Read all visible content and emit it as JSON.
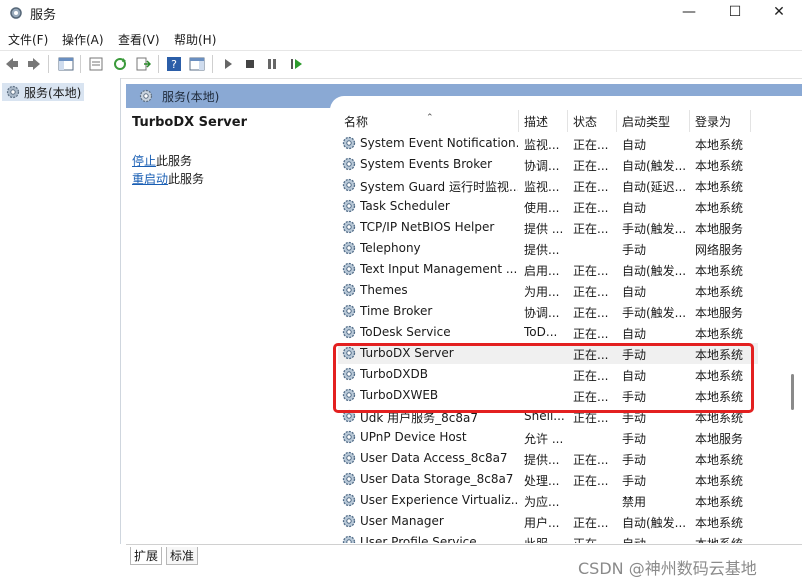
{
  "window": {
    "title": "服务",
    "minimize": "—",
    "maximize": "☐",
    "close": "✕"
  },
  "menu": [
    "文件(F)",
    "操作(A)",
    "查看(V)",
    "帮助(H)"
  ],
  "tree": {
    "node_label": "服务(本地)"
  },
  "main": {
    "header_label": "服务(本地)",
    "selected_service": "TurboDX Server",
    "action_stop_link": "停止",
    "action_stop_suffix": "此服务",
    "action_restart_link": "重启动",
    "action_restart_suffix": "此服务"
  },
  "table": {
    "columns": [
      "名称",
      "描述",
      "状态",
      "启动类型",
      "登录为"
    ],
    "rows": [
      {
        "name": "System Event Notification...",
        "desc": "监视...",
        "state": "正在...",
        "start": "自动",
        "logon": "本地系统"
      },
      {
        "name": "System Events Broker",
        "desc": "协调...",
        "state": "正在...",
        "start": "自动(触发...",
        "logon": "本地系统"
      },
      {
        "name": "System Guard 运行时监视...",
        "desc": "监视...",
        "state": "正在...",
        "start": "自动(延迟...",
        "logon": "本地系统"
      },
      {
        "name": "Task Scheduler",
        "desc": "使用...",
        "state": "正在...",
        "start": "自动",
        "logon": "本地系统"
      },
      {
        "name": "TCP/IP NetBIOS Helper",
        "desc": "提供 ...",
        "state": "正在...",
        "start": "手动(触发...",
        "logon": "本地服务"
      },
      {
        "name": "Telephony",
        "desc": "提供...",
        "state": "",
        "start": "手动",
        "logon": "网络服务"
      },
      {
        "name": "Text Input Management ...",
        "desc": "启用...",
        "state": "正在...",
        "start": "自动(触发...",
        "logon": "本地系统"
      },
      {
        "name": "Themes",
        "desc": "为用...",
        "state": "正在...",
        "start": "自动",
        "logon": "本地系统"
      },
      {
        "name": "Time Broker",
        "desc": "协调...",
        "state": "正在...",
        "start": "手动(触发...",
        "logon": "本地服务"
      },
      {
        "name": "ToDesk Service",
        "desc": "ToD...",
        "state": "正在...",
        "start": "自动",
        "logon": "本地系统"
      },
      {
        "name": "TurboDX Server",
        "desc": "",
        "state": "正在...",
        "start": "手动",
        "logon": "本地系统"
      },
      {
        "name": "TurboDXDB",
        "desc": "",
        "state": "正在...",
        "start": "自动",
        "logon": "本地系统"
      },
      {
        "name": "TurboDXWEB",
        "desc": "",
        "state": "正在...",
        "start": "手动",
        "logon": "本地系统"
      },
      {
        "name": "Udk 用户服务_8c8a7",
        "desc": "Shell...",
        "state": "正在...",
        "start": "手动",
        "logon": "本地系统"
      },
      {
        "name": "UPnP Device Host",
        "desc": "允许 ...",
        "state": "",
        "start": "手动",
        "logon": "本地服务"
      },
      {
        "name": "User Data Access_8c8a7",
        "desc": "提供...",
        "state": "正在...",
        "start": "手动",
        "logon": "本地系统"
      },
      {
        "name": "User Data Storage_8c8a7",
        "desc": "处理...",
        "state": "正在...",
        "start": "手动",
        "logon": "本地系统"
      },
      {
        "name": "User Experience Virtualiz...",
        "desc": "为应...",
        "state": "",
        "start": "禁用",
        "logon": "本地系统"
      },
      {
        "name": "User Manager",
        "desc": "用户...",
        "state": "正在...",
        "start": "自动(触发...",
        "logon": "本地系统"
      },
      {
        "name": "User Profile Service",
        "desc": "此服...",
        "state": "正在...",
        "start": "自动",
        "logon": "本地系统"
      }
    ]
  },
  "tabs": [
    "扩展",
    "标准"
  ],
  "watermark": "CSDN @神州数码云基地",
  "colors": {
    "header_blue": "#8aa9d4",
    "highlight_red": "#e32020",
    "link_blue": "#1a5fb4"
  }
}
